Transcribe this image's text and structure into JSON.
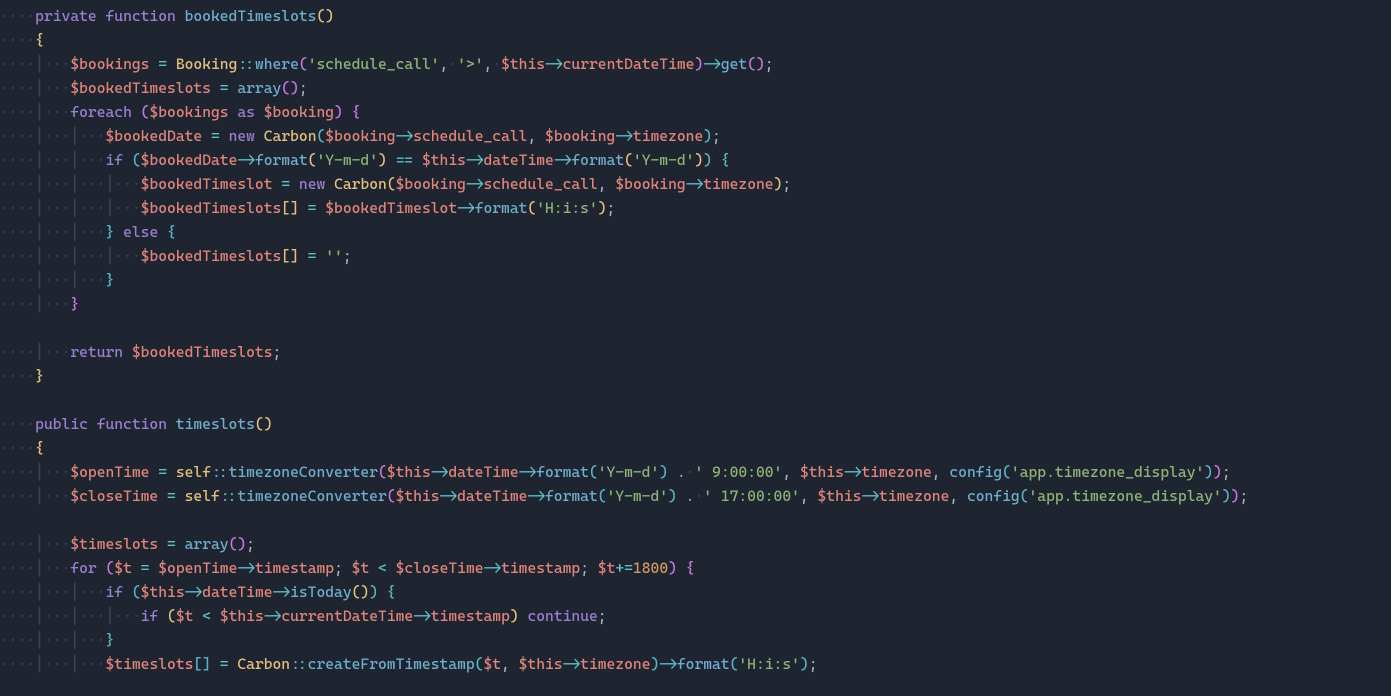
{
  "code": {
    "lines": [
      "    private function bookedTimeslots()",
      "    {",
      "        $bookings = Booking::where('schedule_call', '>', $this->currentDateTime)->get();",
      "        $bookedTimeslots = array();",
      "        foreach ($bookings as $booking) {",
      "            $bookedDate = new Carbon($booking->schedule_call, $booking->timezone);",
      "            if ($bookedDate->format('Y-m-d') == $this->dateTime->format('Y-m-d')) {",
      "                $bookedTimeslot = new Carbon($booking->schedule_call, $booking->timezone);",
      "                $bookedTimeslots[] = $bookedTimeslot->format('H:i:s');",
      "            } else {",
      "                $bookedTimeslots[] = '';",
      "            }",
      "        }",
      "",
      "        return $bookedTimeslots;",
      "    }",
      "",
      "    public function timeslots()",
      "    {",
      "        $openTime = self::timezoneConverter($this->dateTime->format('Y-m-d') . ' 9:00:00', $this->timezone, config('app.timezone_display'));",
      "        $closeTime = self::timezoneConverter($this->dateTime->format('Y-m-d') . ' 17:00:00', $this->timezone, config('app.timezone_display'));",
      "",
      "        $timeslots = array();",
      "        for ($t = $openTime->timestamp; $t < $closeTime->timestamp; $t+=1800) {",
      "            if ($this->dateTime->isToday()) {",
      "                if ($t < $this->currentDateTime->timestamp) continue;",
      "            }",
      "            $timeslots[] = Carbon::createFromTimestamp($t, $this->timezone)->format('H:i:s');"
    ]
  },
  "tokens": {
    "keywords": [
      "private",
      "public",
      "function",
      "foreach",
      "for",
      "if",
      "else",
      "as",
      "return",
      "new",
      "continue"
    ],
    "classes": [
      "Booking",
      "Carbon"
    ]
  }
}
